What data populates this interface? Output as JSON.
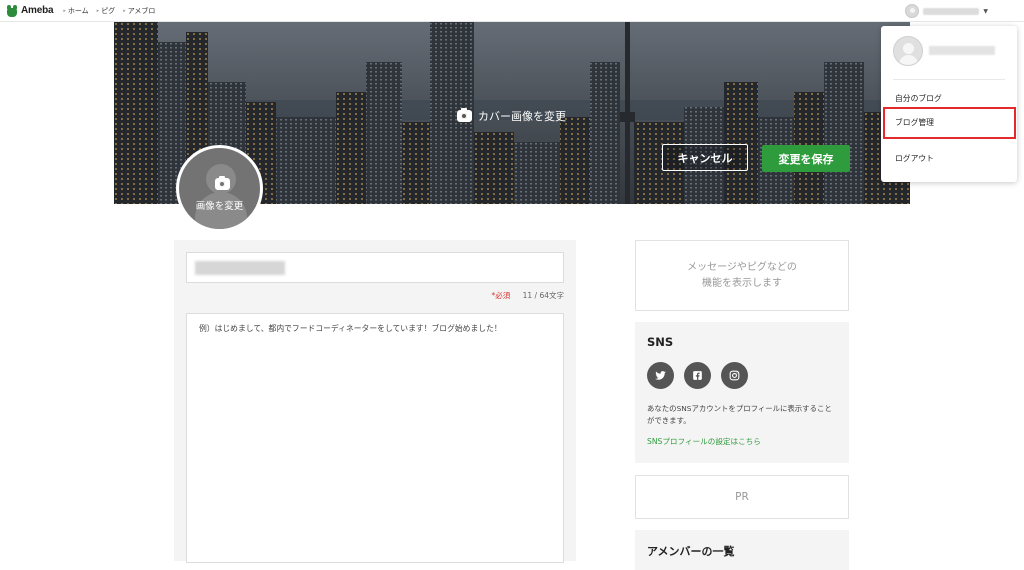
{
  "header": {
    "logo_text": "Ameba",
    "nav": [
      {
        "label": "ホーム"
      },
      {
        "label": "ピグ"
      },
      {
        "label": "アメブロ"
      }
    ],
    "caret": "▼"
  },
  "cover": {
    "change_label": "カバー画像を変更",
    "cancel_label": "キャンセル",
    "save_label": "変更を保存"
  },
  "profile_image": {
    "change_label": "画像を変更"
  },
  "form": {
    "required_label": "*必須",
    "char_count": "11 / 64文字",
    "bio_placeholder": "例）はじめまして、都内でフードコーディネーターをしています！ブログ始めました！"
  },
  "sidebar": {
    "message_line1": "メッセージやピグなどの",
    "message_line2": "機能を表示します",
    "sns": {
      "title": "SNS",
      "icons": [
        "twitter-icon",
        "facebook-icon",
        "instagram-icon"
      ],
      "description": "あなたのSNSアカウントをプロフィールに表示することができます。",
      "link_label": "SNSプロフィールの設定はこちら"
    },
    "pr_label": "PR",
    "members_title": "アメンバーの一覧"
  },
  "dropdown": {
    "items": [
      {
        "label": "自分のブログ"
      },
      {
        "label": "ブログ管理"
      },
      {
        "label": "ログアウト"
      }
    ]
  },
  "colors": {
    "brand_green": "#2e9c3d",
    "highlight_red": "#e32b2b",
    "required_red": "#d9332c"
  }
}
